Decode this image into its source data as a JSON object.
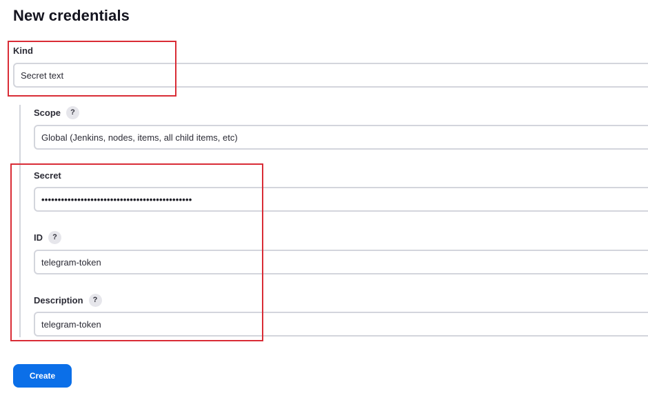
{
  "page": {
    "title": "New credentials"
  },
  "form": {
    "kind": {
      "label": "Kind",
      "value": "Secret text"
    },
    "scope": {
      "label": "Scope",
      "help": "?",
      "value": "Global (Jenkins, nodes, items, all child items, etc)"
    },
    "secret": {
      "label": "Secret",
      "value": "••••••••••••••••••••••••••••••••••••••••••••••"
    },
    "id": {
      "label": "ID",
      "help": "?",
      "value": "telegram-token"
    },
    "description": {
      "label": "Description",
      "help": "?",
      "value": "telegram-token"
    }
  },
  "actions": {
    "create_label": "Create"
  },
  "colors": {
    "primary": "#0b6fe8",
    "highlight": "#d92b35",
    "border": "#d3d5dc"
  },
  "icons": {
    "help": "question-mark-circle-icon"
  }
}
